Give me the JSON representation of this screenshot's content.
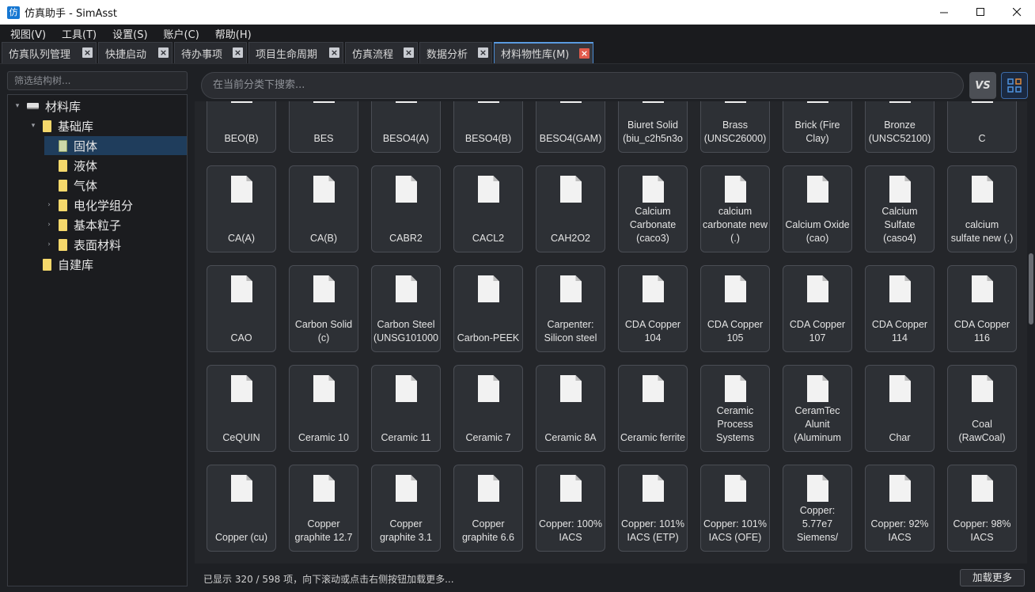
{
  "window": {
    "title": "仿真助手 - SimAsst",
    "app_icon_glyph": "仿",
    "controls": [
      "minimize-icon",
      "maximize-icon",
      "close-icon"
    ]
  },
  "menu": [
    "视图(V)",
    "工具(T)",
    "设置(S)",
    "账户(C)",
    "帮助(H)"
  ],
  "tabs": [
    {
      "label": "仿真队列管理",
      "width": 120
    },
    {
      "label": "快捷启动",
      "width": 94
    },
    {
      "label": "待办事项",
      "width": 92
    },
    {
      "label": "项目生命周期",
      "width": 120
    },
    {
      "label": "仿真流程",
      "width": 92
    },
    {
      "label": "数据分析",
      "width": 92
    },
    {
      "label": "材料物性库(M)",
      "width": 126,
      "active": true
    }
  ],
  "sidebar": {
    "filter_placeholder": "筛选结构树...",
    "tree": [
      {
        "label": "材料库",
        "level": 0,
        "icon": "drive-icon",
        "arrow": "expanded"
      },
      {
        "label": "基础库",
        "level": 1,
        "icon": "folder-icon",
        "arrow": "expanded"
      },
      {
        "label": "固体",
        "level": 2,
        "icon": "folder-open-icon",
        "selected": true
      },
      {
        "label": "液体",
        "level": 2,
        "icon": "folder-icon"
      },
      {
        "label": "气体",
        "level": 2,
        "icon": "folder-icon"
      },
      {
        "label": "电化学组分",
        "level": 2,
        "icon": "folder-icon",
        "arrow": "collapsed"
      },
      {
        "label": "基本粒子",
        "level": 2,
        "icon": "folder-icon",
        "arrow": "collapsed"
      },
      {
        "label": "表面材料",
        "level": 2,
        "icon": "folder-icon",
        "arrow": "collapsed"
      },
      {
        "label": "自建库",
        "level": 1,
        "icon": "folder-icon"
      }
    ]
  },
  "search": {
    "placeholder": "在当前分类下搜索...",
    "vs_label": "VS"
  },
  "materials": [
    [
      "BEO(B)",
      "BES",
      "BESO4(A)",
      "BESO4(B)",
      "BESO4(GAM)",
      "Biuret Solid (biu_c2h5n3o",
      "Brass (UNSC26000)",
      "Brick (Fire Clay)",
      "Bronze (UNSC52100)",
      "C"
    ],
    [
      "CA(A)",
      "CA(B)",
      "CABR2",
      "CACL2",
      "CAH2O2",
      "Calcium Carbonate (caco3)",
      "calcium carbonate new (.)",
      "Calcium Oxide (cao)",
      "Calcium Sulfate (caso4)",
      "calcium sulfate new (.)"
    ],
    [
      "CAO",
      "Carbon Solid (c)",
      "Carbon Steel (UNSG101000",
      "Carbon-PEEK",
      "Carpenter: Silicon steel",
      "CDA Copper 104",
      "CDA Copper 105",
      "CDA Copper 107",
      "CDA Copper 114",
      "CDA Copper 116"
    ],
    [
      "CeQUIN",
      "Ceramic 10",
      "Ceramic 11",
      "Ceramic 7",
      "Ceramic 8A",
      "Ceramic ferrite",
      "Ceramic Process Systems",
      "CeramTec Alunit (Aluminum",
      "Char",
      "Coal (RawCoal)"
    ],
    [
      "Copper (cu)",
      "Copper graphite 12.7",
      "Copper graphite 3.1",
      "Copper graphite 6.6",
      "Copper: 100% IACS",
      "Copper: 101% IACS (ETP)",
      "Copper: 101% IACS (OFE)",
      "Copper: 5.77e7 Siemens/",
      "Copper: 92% IACS",
      "Copper: 98% IACS"
    ]
  ],
  "status": {
    "text": "已显示 320 / 598 项，向下滚动或点击右侧按钮加载更多...",
    "load_more": "加载更多"
  }
}
